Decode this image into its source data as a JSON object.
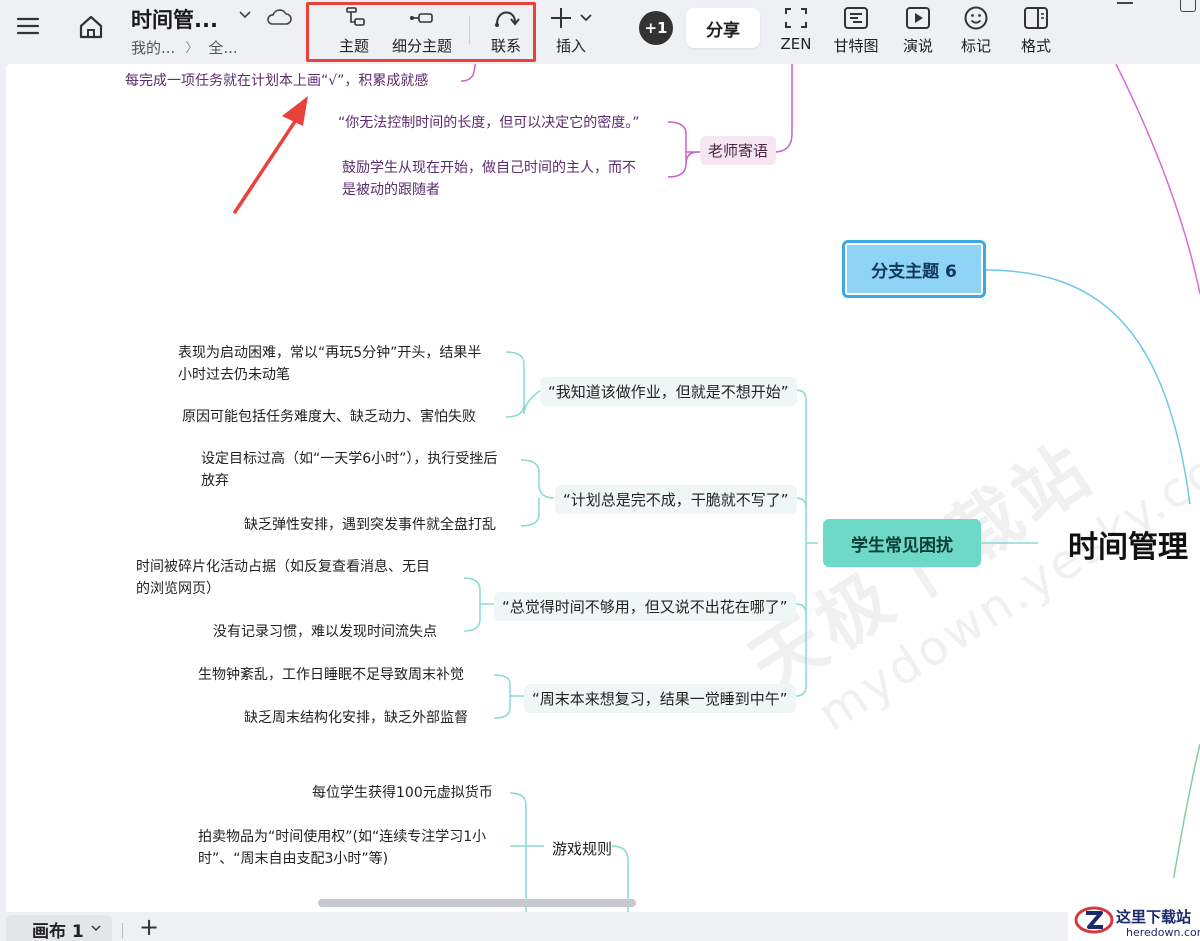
{
  "toolbar": {
    "title": "时间管...",
    "breadcrumb": [
      "我的...",
      "全..."
    ],
    "breadcrumb_sep": "〉",
    "buttons": {
      "topic": "主题",
      "subtopic": "细分主题",
      "relation": "联系",
      "insert": "插入",
      "plus_one": "+1",
      "share": "分享",
      "zen": "ZEN",
      "gantt": "甘特图",
      "present": "演说",
      "mark": "标记",
      "format": "格式"
    },
    "highlight_color": "#e8423c"
  },
  "map": {
    "top_leaf_1": "每完成一项任务就在计划本上画“√”，积累成就感",
    "teacher": {
      "label": "老师寄语",
      "leaves": [
        "“你无法控制时间的长度，但可以决定它的密度。”",
        "鼓励学生从现在开始，做自己时间的主人，而不",
        "是被动的跟随者"
      ]
    },
    "branch6": "分支主题 6",
    "central": "时间管理",
    "students": {
      "label": "学生常见困扰",
      "subs": [
        {
          "label": "“我知道该做作业，但就是不想开始”",
          "leaves": [
            "表现为启动困难，常以“再玩5分钟”开头，结果半",
            "小时过去仍未动笔",
            "原因可能包括任务难度大、缺乏动力、害怕失败"
          ]
        },
        {
          "label": "“计划总是完不成，干脆就不写了”",
          "leaves": [
            "设定目标过高（如“一天学6小时”），执行受挫后",
            "放弃",
            "缺乏弹性安排，遇到突发事件就全盘打乱"
          ]
        },
        {
          "label": "“总觉得时间不够用，但又说不出花在哪了”",
          "leaves": [
            "时间被碎片化活动占据（如反复查看消息、无目",
            "的浏览网页）",
            "没有记录习惯，难以发现时间流失点"
          ]
        },
        {
          "label": "“周末本来想复习，结果一觉睡到中午”",
          "leaves": [
            "生物钟紊乱，工作日睡眠不足导致周末补觉",
            "缺乏周末结构化安排，缺乏外部监督"
          ]
        }
      ]
    },
    "game": {
      "label": "游戏规则",
      "leaves": [
        "每位学生获得100元虚拟货币",
        "拍卖物品为“时间使用权”(如“连续专注学习1小",
        "时”、“周末自由支配3小时”等)"
      ]
    }
  },
  "watermark": {
    "line1": "天极下载站",
    "line2": "mydown.yesky.com"
  },
  "bottom": {
    "tab_label": "画布 1",
    "add": "+"
  },
  "logo": {
    "name": "这里下载站",
    "url": "heredown.com"
  }
}
